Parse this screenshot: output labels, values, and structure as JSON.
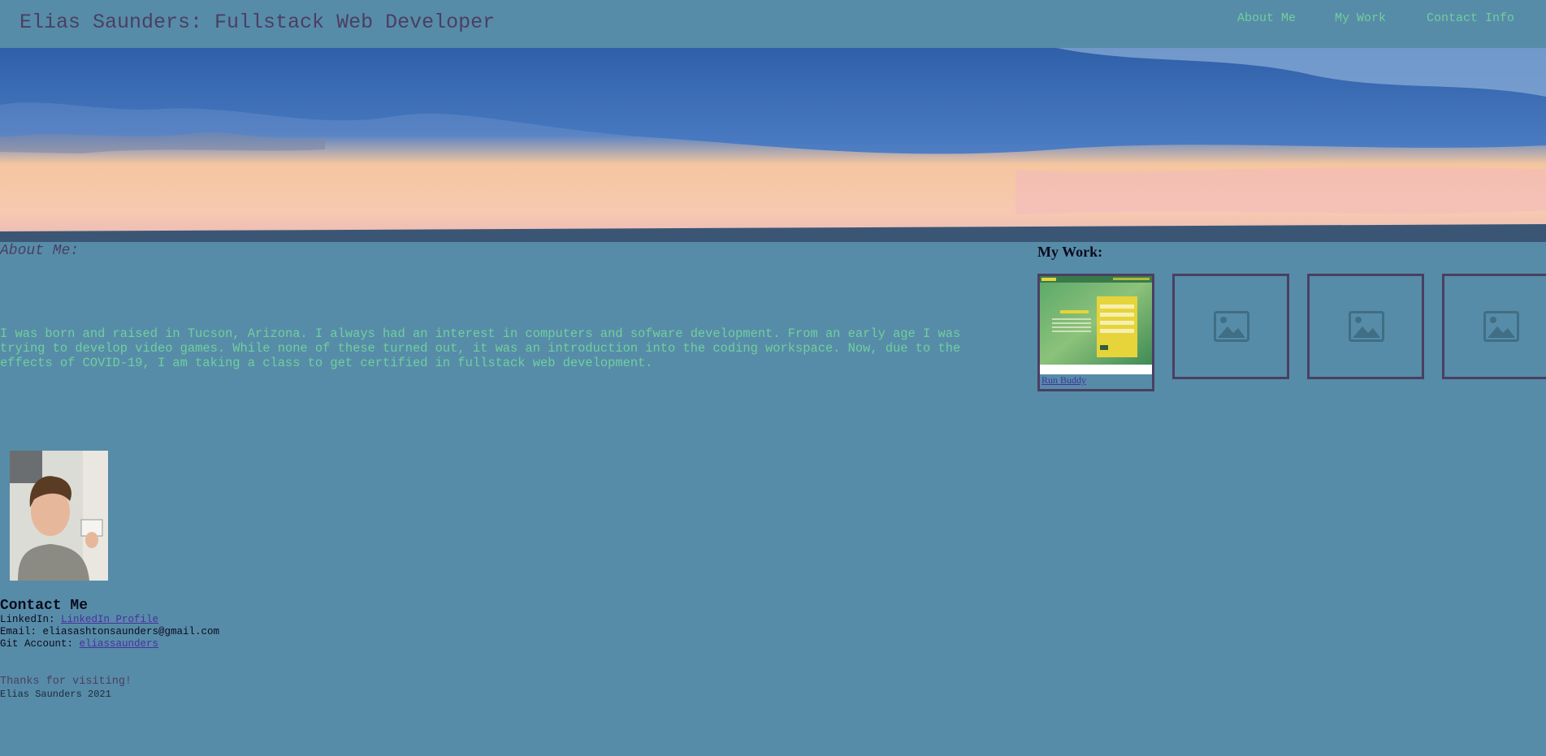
{
  "header": {
    "title": "Elias Saunders: Fullstack Web Developer",
    "nav": [
      {
        "label": "About Me"
      },
      {
        "label": "My Work"
      },
      {
        "label": "Contact Info"
      }
    ]
  },
  "about": {
    "heading": "About Me:",
    "text": "I was born and raised in Tucson, Arizona. I always had an interest in computers and sofware development. From an early age I was trying to develop video games. While none of these turned out, it was an introduction into the coding workspace. Now, due to the effects of COVID-19, I am taking a class to get certified in fullstack web development."
  },
  "contact": {
    "heading": "Contact Me",
    "linkedin_label": "LinkedIn: ",
    "linkedin_link": "LinkedIn Profile",
    "email_label": "Email: ",
    "email_value": "eliasashtonsaunders@gmail.com",
    "git_label": "Git Account: ",
    "git_link": "eliassaunders"
  },
  "footer": {
    "thanks": "Thanks for visiting!",
    "name": "Elias Saunders 2021"
  },
  "work": {
    "heading": "My Work:",
    "projects": [
      {
        "title": "Run Buddy"
      },
      {
        "title": ""
      },
      {
        "title": ""
      },
      {
        "title": ""
      }
    ]
  },
  "colors": {
    "background": "#578ca8",
    "title": "#4a3f63",
    "accent": "#6fcf9d",
    "link": "#4a2fa0"
  },
  "icons": {
    "placeholder": "image-placeholder-icon"
  }
}
